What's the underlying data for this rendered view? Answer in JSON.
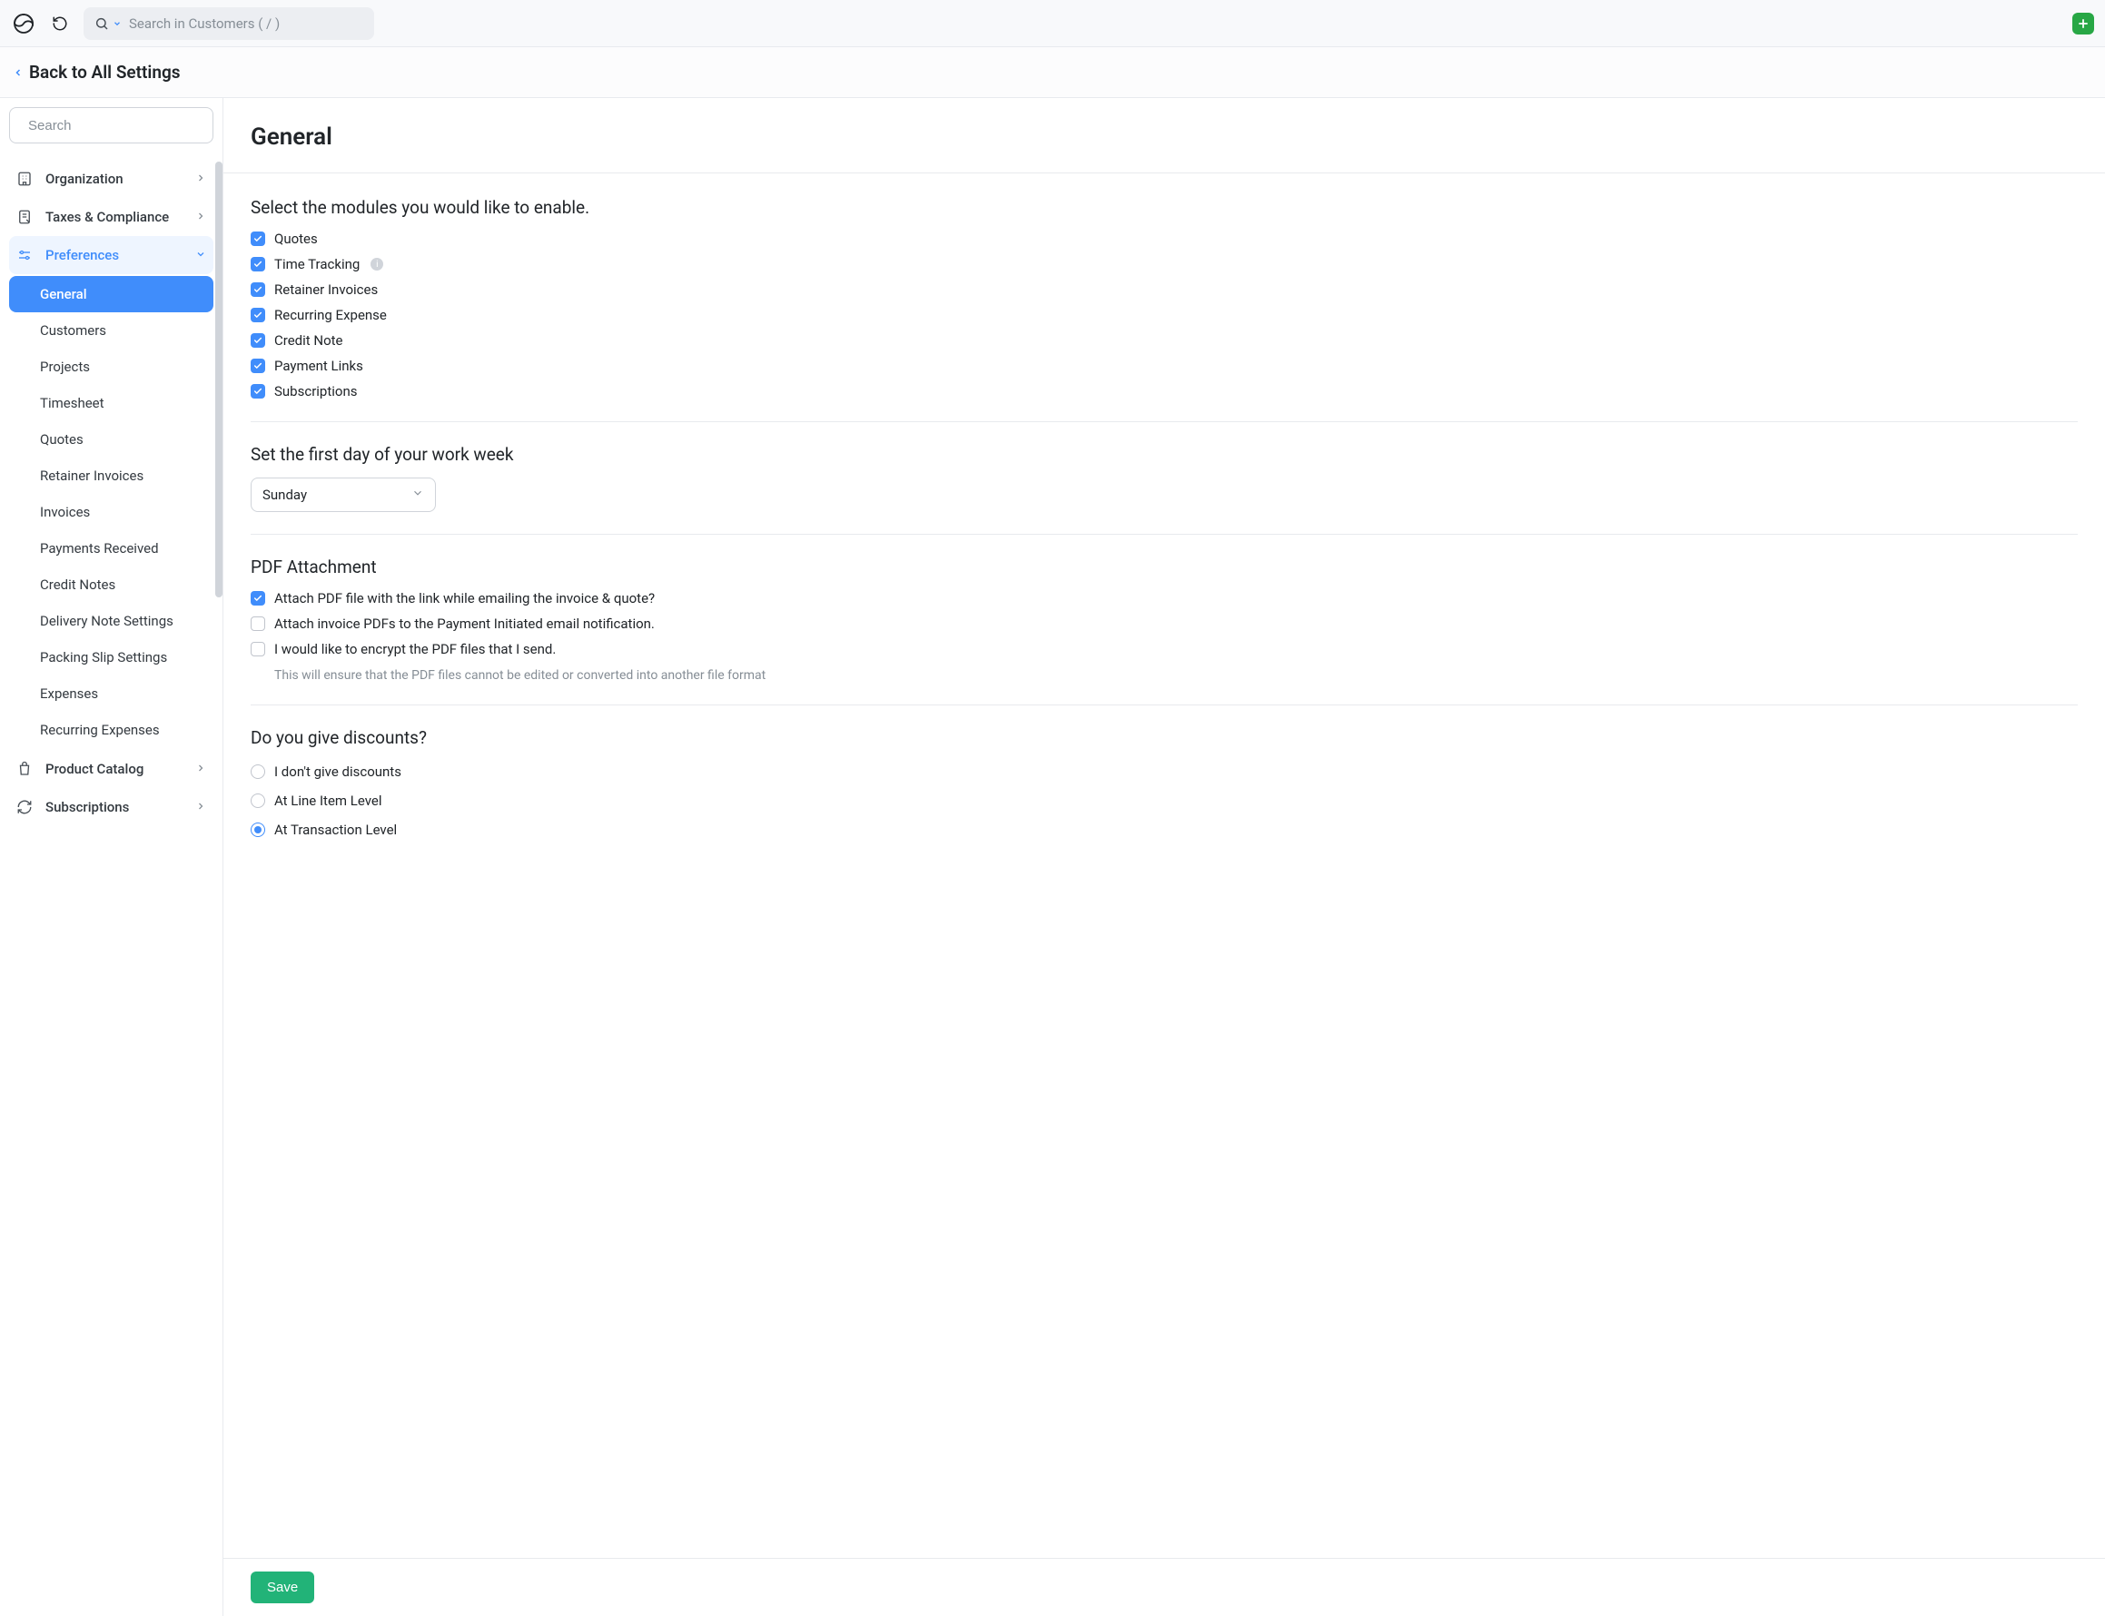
{
  "topbar": {
    "search_placeholder": "Search in Customers ( / )"
  },
  "back": {
    "label": "Back to All Settings"
  },
  "sidebar": {
    "search_placeholder": "Search",
    "sections": {
      "organization": "Organization",
      "taxes": "Taxes & Compliance",
      "preferences": "Preferences",
      "product_catalog": "Product Catalog",
      "subscriptions": "Subscriptions"
    },
    "preferences_items": [
      "General",
      "Customers",
      "Projects",
      "Timesheet",
      "Quotes",
      "Retainer Invoices",
      "Invoices",
      "Payments Received",
      "Credit Notes",
      "Delivery Note Settings",
      "Packing Slip Settings",
      "Expenses",
      "Recurring Expenses"
    ]
  },
  "page": {
    "title": "General",
    "modules": {
      "label": "Select the modules you would like to enable.",
      "items": [
        {
          "label": "Quotes",
          "checked": true,
          "info": false
        },
        {
          "label": "Time Tracking",
          "checked": true,
          "info": true
        },
        {
          "label": "Retainer Invoices",
          "checked": true,
          "info": false
        },
        {
          "label": "Recurring Expense",
          "checked": true,
          "info": false
        },
        {
          "label": "Credit Note",
          "checked": true,
          "info": false
        },
        {
          "label": "Payment Links",
          "checked": true,
          "info": false
        },
        {
          "label": "Subscriptions",
          "checked": true,
          "info": false
        }
      ]
    },
    "workweek": {
      "label": "Set the first day of your work week",
      "value": "Sunday"
    },
    "pdf": {
      "label": "PDF Attachment",
      "items": [
        {
          "label": "Attach PDF file with the link while emailing the invoice & quote?",
          "checked": true
        },
        {
          "label": "Attach invoice PDFs to the Payment Initiated email notification.",
          "checked": false
        },
        {
          "label": "I would like to encrypt the PDF files that I send.",
          "checked": false,
          "hint": "This will ensure that the PDF files cannot be edited or converted into another file format"
        }
      ]
    },
    "discounts": {
      "label": "Do you give discounts?",
      "options": [
        {
          "label": "I don't give discounts",
          "checked": false
        },
        {
          "label": "At Line Item Level",
          "checked": false
        },
        {
          "label": "At Transaction Level",
          "checked": true
        }
      ]
    },
    "save_label": "Save"
  }
}
